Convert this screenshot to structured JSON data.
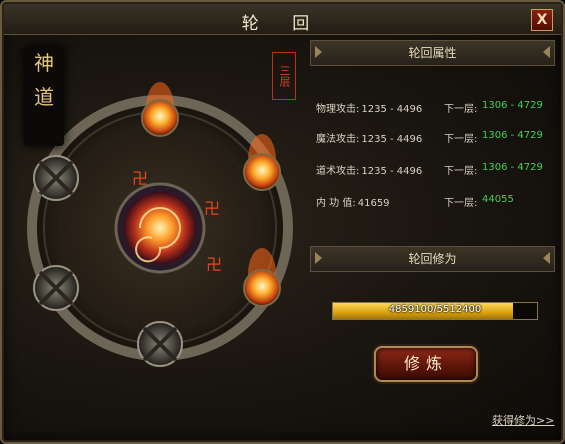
{
  "window": {
    "title": "轮 回",
    "close_label": "X"
  },
  "left": {
    "calligraphy": [
      "神",
      "道"
    ],
    "layer_stamp": "三层"
  },
  "attributes": {
    "header": "轮回属性",
    "next_label": "下一层:",
    "rows": [
      {
        "label": "物理攻击:",
        "current": "1235 - 4496",
        "next": "1306 - 4729"
      },
      {
        "label": "魔法攻击:",
        "current": "1235 - 4496",
        "next": "1306 - 4729"
      },
      {
        "label": "道术攻击:",
        "current": "1235 - 4496",
        "next": "1306 - 4729"
      },
      {
        "label": "内 功 值:",
        "current": "41659",
        "next": "44055"
      }
    ]
  },
  "cultivation": {
    "header": "轮回修为",
    "progress_text": "4859100/5512400",
    "progress_fraction": 0.8815
  },
  "buttons": {
    "cultivate": "修炼",
    "get_cultivation": "获得修为>>"
  },
  "colors": {
    "next_value": "#3fd352",
    "stamp": "#d6402a",
    "progress": "#d8a20f"
  }
}
